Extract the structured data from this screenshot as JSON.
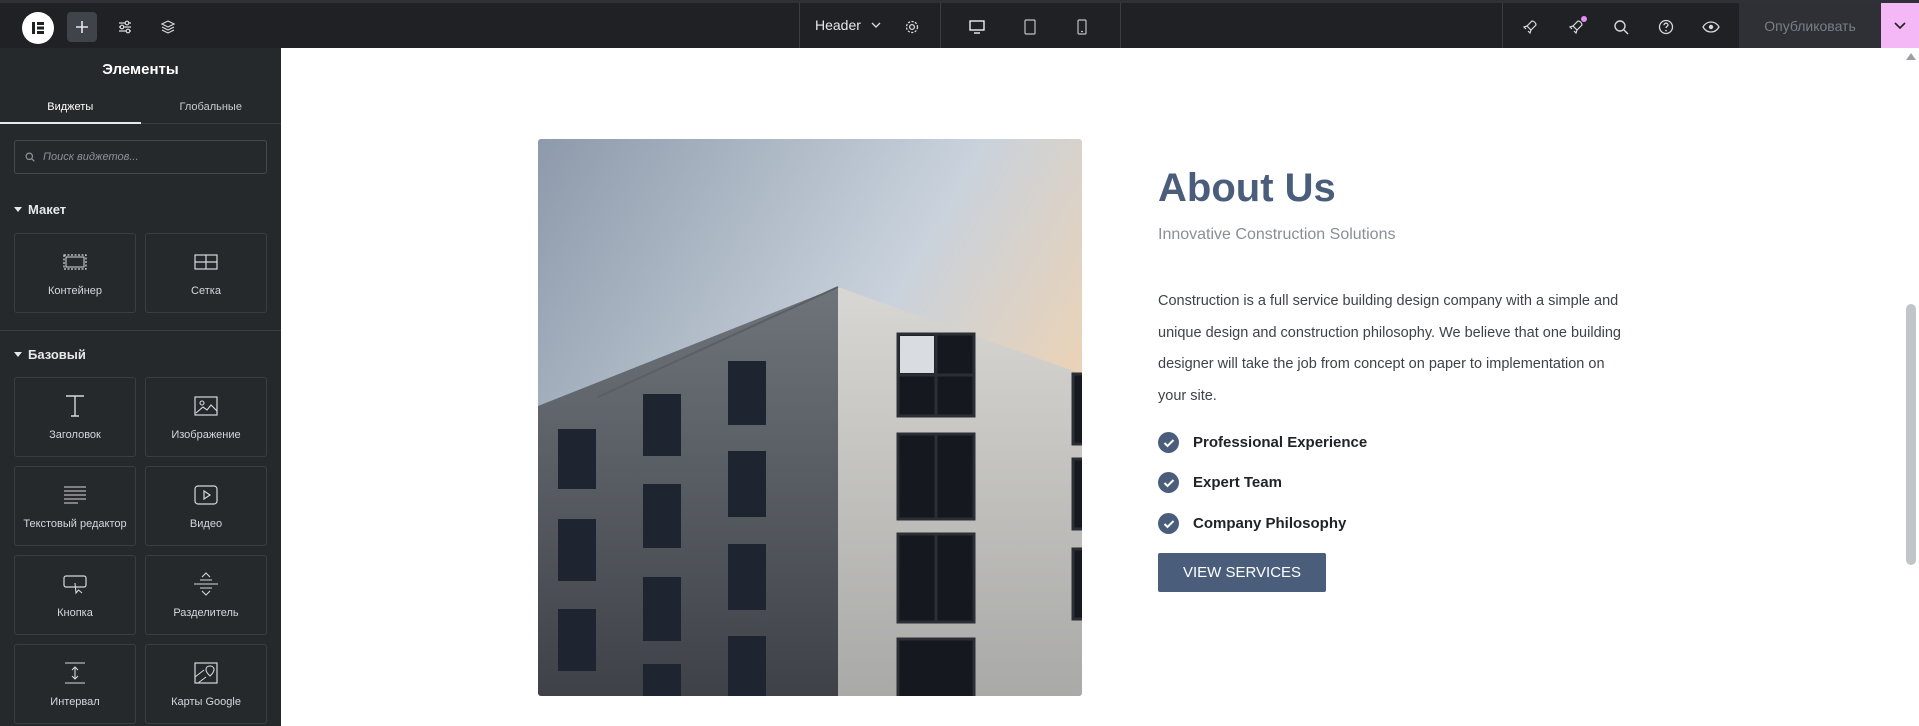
{
  "topbar": {
    "header_label": "Header",
    "publish_label": "Опубликовать"
  },
  "sidebar": {
    "title": "Элементы",
    "tabs": [
      {
        "label": "Виджеты",
        "active": true
      },
      {
        "label": "Глобальные",
        "active": false
      }
    ],
    "search_placeholder": "Поиск виджетов...",
    "sections": [
      {
        "title": "Макет",
        "widgets": [
          {
            "label": "Контейнер",
            "icon": "container-icon"
          },
          {
            "label": "Сетка",
            "icon": "grid-icon"
          }
        ]
      },
      {
        "title": "Базовый",
        "widgets": [
          {
            "label": "Заголовок",
            "icon": "heading-icon"
          },
          {
            "label": "Изображение",
            "icon": "image-icon"
          },
          {
            "label": "Текстовый редактор",
            "icon": "text-editor-icon"
          },
          {
            "label": "Видео",
            "icon": "video-icon"
          },
          {
            "label": "Кнопка",
            "icon": "button-icon"
          },
          {
            "label": "Разделитель",
            "icon": "divider-icon"
          },
          {
            "label": "Интервал",
            "icon": "spacer-icon"
          },
          {
            "label": "Карты Google",
            "icon": "map-icon"
          }
        ]
      }
    ]
  },
  "content": {
    "title": "About Us",
    "subtitle": "Innovative Construction Solutions",
    "body_lines": [
      "Construction is a full service building design company with a simple and",
      "unique design and construction philosophy. We believe that one building",
      "designer will take the job from concept on paper to implementation on",
      "your site."
    ],
    "features": [
      "Professional Experience",
      "Expert Team",
      "Company Philosophy"
    ],
    "cta_label": "VIEW SERVICES"
  },
  "colors": {
    "accent": "#4a5e7c",
    "topbar_bg": "#1f2124",
    "sidebar_bg": "#26292c",
    "publish_menu": "#f3b8f5"
  }
}
